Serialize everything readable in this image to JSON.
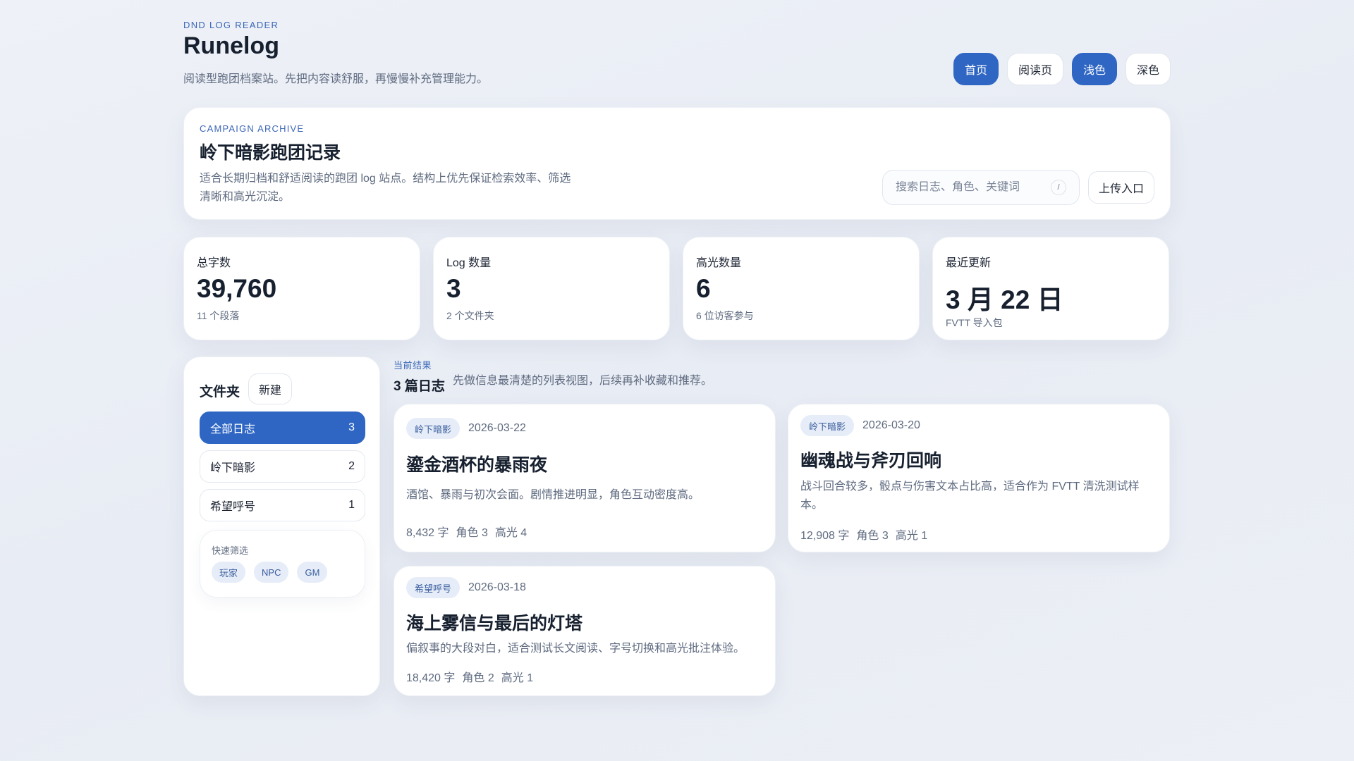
{
  "header": {
    "kicker": "DND LOG READER",
    "title": "Runelog",
    "subtitle": "阅读型跑团档案站。先把内容读舒服，再慢慢补充管理能力。",
    "nav": [
      "首页",
      "阅读页",
      "浅色",
      "深色"
    ],
    "active_nav": [
      "首页",
      "浅色"
    ]
  },
  "hero": {
    "kicker": "CAMPAIGN ARCHIVE",
    "title": "岭下暗影跑团记录",
    "description": "适合长期归档和舒适阅读的跑团 log 站点。结构上优先保证检索效率、筛选清晰和高光沉淀。",
    "search_placeholder": "搜索日志、角色、关键词",
    "search_value": "",
    "search_shortcut": "/",
    "upload_label": "上传入口"
  },
  "stats": [
    {
      "label": "总字数",
      "value": "39,760",
      "note": "11 个段落"
    },
    {
      "label": "Log 数量",
      "value": "3",
      "note": "2 个文件夹"
    },
    {
      "label": "高光数量",
      "value": "6",
      "note": "6 位访客参与"
    },
    {
      "label": "最近更新",
      "value": "3 月 22 日",
      "note": "FVTT 导入包"
    }
  ],
  "sidebar": {
    "title": "文件夹",
    "new_label": "新建",
    "folders": [
      {
        "name": "全部日志",
        "count": "3",
        "active": true
      },
      {
        "name": "岭下暗影",
        "count": "2",
        "active": false
      },
      {
        "name": "希望呼号",
        "count": "1",
        "active": false
      }
    ],
    "quick_filter_title": "快速筛选",
    "quick_filters": [
      "玩家",
      "NPC",
      "GM"
    ]
  },
  "results": {
    "kicker": "当前结果",
    "count_label": "3 篇日志",
    "description": "先做信息最清楚的列表视图，后续再补收藏和推荐。"
  },
  "logs": [
    {
      "tag": "岭下暗影",
      "date": "2026-03-22",
      "title": "鎏金酒杯的暴雨夜",
      "description": "酒馆、暴雨与初次会面。剧情推进明显，角色互动密度高。",
      "words": "8,432 字",
      "roles": "角色 3",
      "highlights": "高光 4"
    },
    {
      "tag": "岭下暗影",
      "date": "2026-03-20",
      "title": "幽魂战与斧刃回响",
      "description": "战斗回合较多，骰点与伤害文本占比高，适合作为 FVTT 清洗测试样本。",
      "words": "12,908 字",
      "roles": "角色 3",
      "highlights": "高光 1"
    },
    {
      "tag": "希望呼号",
      "date": "2026-03-18",
      "title": "海上雾信与最后的灯塔",
      "description": "偏叙事的大段对白，适合测试长文阅读、字号切换和高光批注体验。",
      "words": "18,420 字",
      "roles": "角色 2",
      "highlights": "高光 1"
    }
  ]
}
